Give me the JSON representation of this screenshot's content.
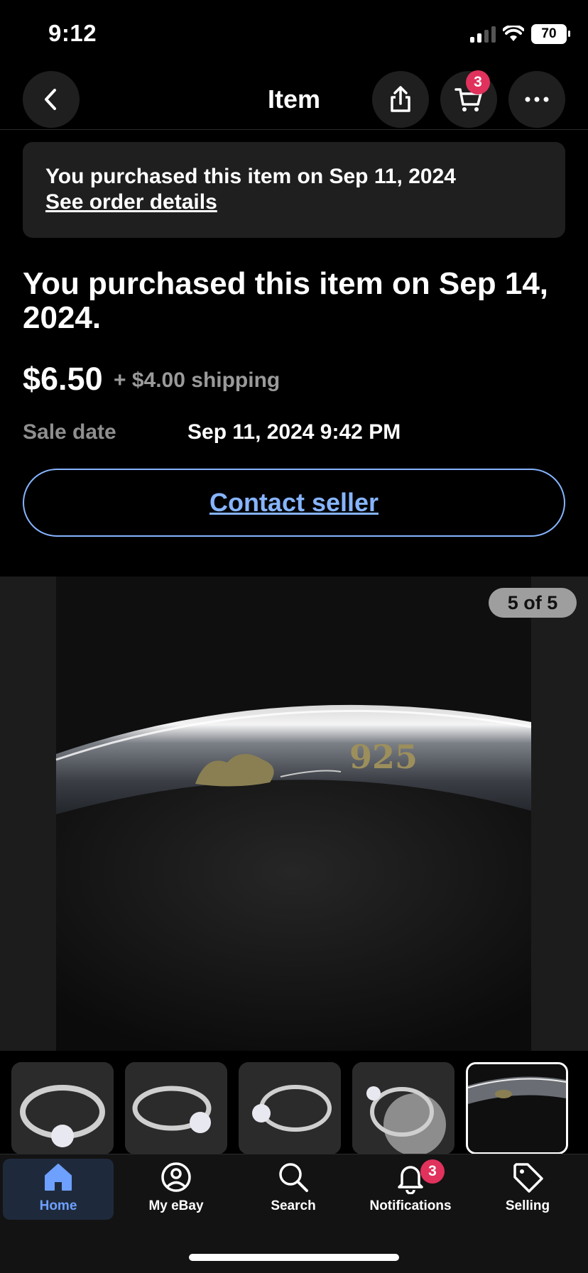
{
  "status_bar": {
    "time": "9:12",
    "battery": "70"
  },
  "header": {
    "title": "Item",
    "cart_count": "3"
  },
  "banner": {
    "text": "You purchased this item on Sep 11, 2024",
    "link": "See order details"
  },
  "listing": {
    "headline": "You purchased this item on Sep 14, 2024.",
    "price": "$6.50",
    "shipping": "+ $4.00 shipping",
    "sale_label": "Sale date",
    "sale_value": "Sep 11, 2024 9:42 PM",
    "contact_label": "Contact seller"
  },
  "gallery": {
    "counter": "5 of 5",
    "engraving": "925",
    "selected_index": 5,
    "thumbnails": [
      "ring-front",
      "ring-side",
      "ring-angle",
      "ring-with-coin",
      "ring-hallmark"
    ]
  },
  "tabbar": {
    "items": [
      {
        "label": "Home",
        "icon": "home-icon"
      },
      {
        "label": "My eBay",
        "icon": "account-icon"
      },
      {
        "label": "Search",
        "icon": "search-icon"
      },
      {
        "label": "Notifications",
        "icon": "bell-icon"
      },
      {
        "label": "Selling",
        "icon": "tag-icon"
      }
    ],
    "notifications_count": "3"
  },
  "colors": {
    "accent": "#86b4ff",
    "badge": "#e0325c",
    "active_tab_bg": "#1e2a3c"
  }
}
